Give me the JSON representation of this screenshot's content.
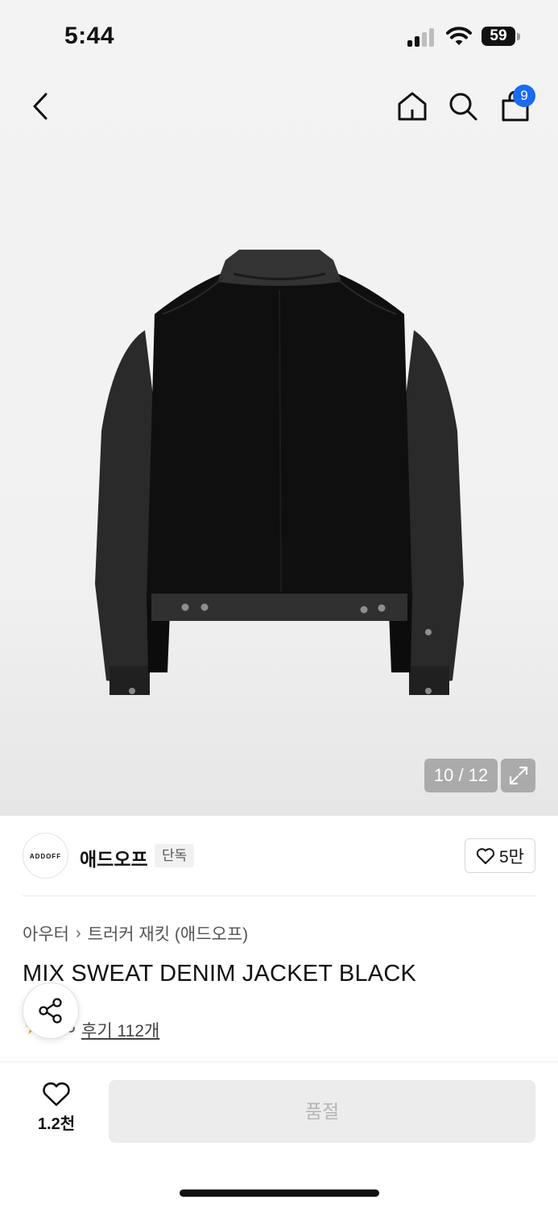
{
  "status_bar": {
    "time": "5:44",
    "battery": "59"
  },
  "nav": {
    "cart_count": "9"
  },
  "gallery": {
    "counter": "10 / 12"
  },
  "brand": {
    "logo_text": "ADDOFF",
    "name": "애드오프",
    "badge": "단독",
    "likes": "5만"
  },
  "breadcrumb": {
    "category": "아우터",
    "subcategory": "트러커 재킷 (애드오프)"
  },
  "product": {
    "title": "MIX SWEAT DENIM JACKET BLACK",
    "rating": "5",
    "reviews": "후기 112개"
  },
  "bottom": {
    "wish_count": "1.2천",
    "action_label": "품절"
  },
  "colors": {
    "badge_blue": "#1a6bf0",
    "star": "#f5a623",
    "soldout_bg": "#ececec"
  },
  "icons": [
    "back-icon",
    "home-icon",
    "search-icon",
    "cart-icon",
    "expand-icon",
    "heart-icon",
    "share-icon",
    "star-icon"
  ]
}
